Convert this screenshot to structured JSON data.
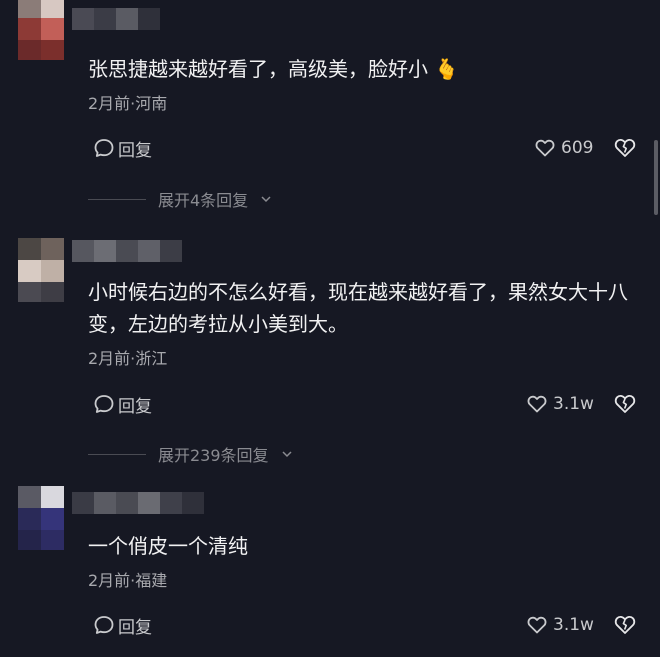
{
  "colors": {
    "background": "#161823",
    "text": "#f1f1f2",
    "meta": "#a8a9ae",
    "action": "#c9cacd"
  },
  "comments": [
    {
      "text": "张思捷越来越好看了，高级美，脸好小 🫰",
      "meta": "2月前·河南",
      "reply_label": "回复",
      "likes": "609",
      "expand_label": "展开4条回复"
    },
    {
      "text": "小时候右边的不怎么好看，现在越来越好看了，果然女大十八变，左边的考拉从小美到大。",
      "meta": "2月前·浙江",
      "reply_label": "回复",
      "likes": "3.1w",
      "expand_label": "展开239条回复"
    },
    {
      "text": "一个俏皮一个清纯",
      "meta": "2月前·福建",
      "reply_label": "回复",
      "likes": "3.1w"
    }
  ],
  "icons": {
    "reply": "comment-bubble-icon",
    "like": "heart-outline-icon",
    "dislike": "broken-heart-icon",
    "expand": "chevron-down-icon"
  }
}
